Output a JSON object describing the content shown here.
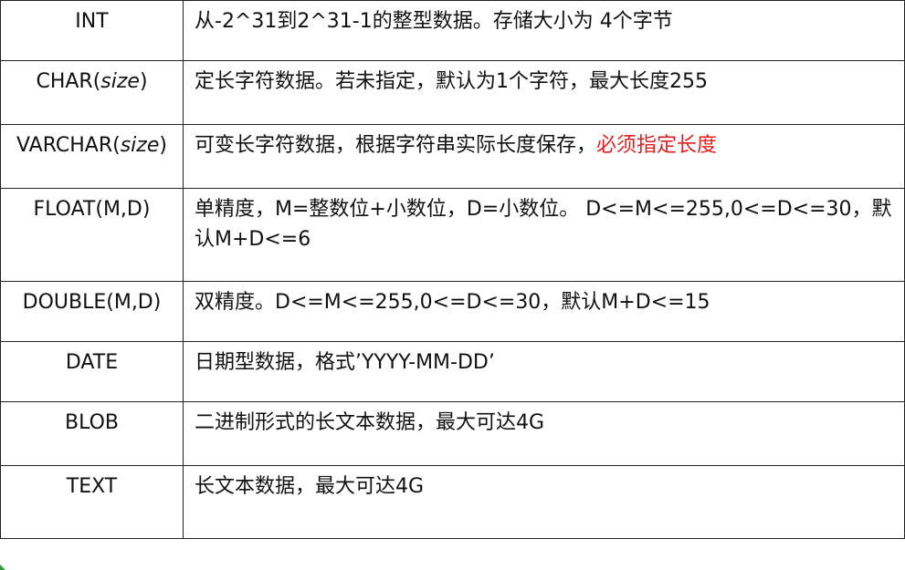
{
  "rows": [
    {
      "type": "INT",
      "type_param": "",
      "type_suffix": "",
      "desc": "从-2^31到2^31-1的整型数据。存储大小为 4个字节",
      "desc_red": ""
    },
    {
      "type": "CHAR(",
      "type_param": "size",
      "type_suffix": ")",
      "desc": "定长字符数据。若未指定，默认为1个字符，最大长度255",
      "desc_red": ""
    },
    {
      "type": "VARCHAR(",
      "type_param": "size",
      "type_suffix": ")",
      "desc": "可变长字符数据，根据字符串实际长度保存，",
      "desc_red": "必须指定长度"
    },
    {
      "type": "FLOAT(M,D)",
      "type_param": "",
      "type_suffix": "",
      "desc": "单精度，M=整数位+小数位，D=小数位。 D<=M<=255,0<=D<=30，默认M+D<=6",
      "desc_red": ""
    },
    {
      "type": "DOUBLE(M,D)",
      "type_param": "",
      "type_suffix": "",
      "desc": "双精度。D<=M<=255,0<=D<=30，默认M+D<=15",
      "desc_red": ""
    },
    {
      "type": "DATE",
      "type_param": "",
      "type_suffix": "",
      "desc": "日期型数据，格式’YYYY-MM-DD’",
      "desc_red": ""
    },
    {
      "type": "BLOB",
      "type_param": "",
      "type_suffix": "",
      "desc": "二进制形式的长文本数据，最大可达4G",
      "desc_red": ""
    },
    {
      "type": "TEXT",
      "type_param": "",
      "type_suffix": "",
      "desc": "长文本数据，最大可达4G",
      "desc_red": ""
    }
  ],
  "colors": {
    "highlight": "#e02020",
    "border": "#222222"
  }
}
